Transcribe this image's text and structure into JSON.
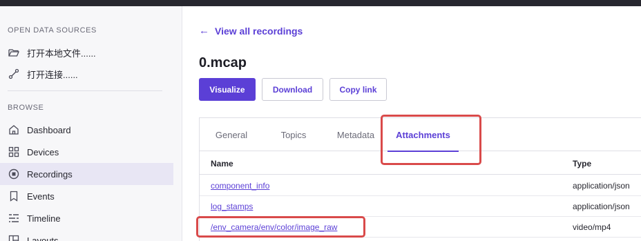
{
  "sidebar": {
    "open_title": "OPEN DATA SOURCES",
    "open_items": [
      {
        "label": "打开本地文件......",
        "icon": "folder-open-icon"
      },
      {
        "label": "打开连接......",
        "icon": "connection-icon"
      }
    ],
    "browse_title": "BROWSE",
    "browse_items": [
      {
        "label": "Dashboard",
        "icon": "home-icon"
      },
      {
        "label": "Devices",
        "icon": "grid-icon"
      },
      {
        "label": "Recordings",
        "icon": "record-icon",
        "active": true
      },
      {
        "label": "Events",
        "icon": "bookmark-icon"
      },
      {
        "label": "Timeline",
        "icon": "timeline-icon"
      },
      {
        "label": "Layouts",
        "icon": "layouts-icon"
      }
    ]
  },
  "main": {
    "back_link": "View all recordings",
    "file_title": "0.mcap",
    "buttons": {
      "visualize": "Visualize",
      "download": "Download",
      "copy_link": "Copy link"
    },
    "tabs": [
      {
        "label": "General"
      },
      {
        "label": "Topics"
      },
      {
        "label": "Metadata"
      },
      {
        "label": "Attachments",
        "active": true
      }
    ],
    "table": {
      "headers": {
        "name": "Name",
        "type": "Type"
      },
      "rows": [
        {
          "name": "component_info",
          "type": "application/json"
        },
        {
          "name": "log_stamps",
          "type": "application/json"
        },
        {
          "name": "/env_camera/env/color/image_raw",
          "type": "video/mp4"
        }
      ]
    }
  },
  "colors": {
    "accent": "#5b3fd6",
    "highlight": "#d94a4a",
    "sidebar_bg": "#f7f7f9",
    "active_bg": "#e8e6f4"
  }
}
